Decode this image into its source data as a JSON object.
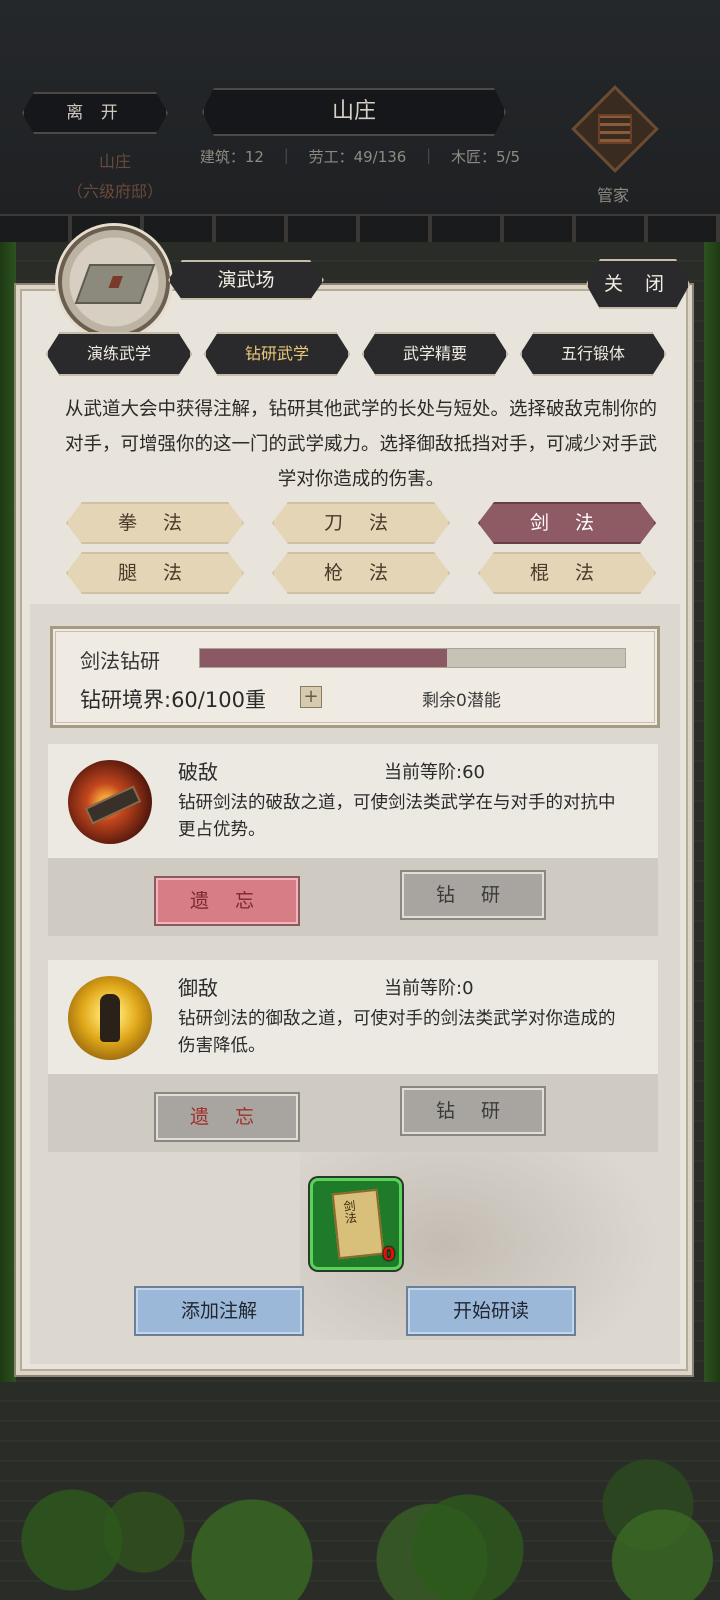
{
  "header": {
    "leave_label": "离 开",
    "location_title": "山庄",
    "location_name": "山庄",
    "location_rank": "（六级府邸）",
    "stats": {
      "buildings": "建筑：12",
      "workers": "劳工：49/136",
      "carpenters": "木匠：5/5"
    },
    "steward_label": "管家"
  },
  "panel": {
    "building_name": "演武场",
    "close_label": "关 闭",
    "tabs": [
      {
        "label": "演练武学",
        "active": false
      },
      {
        "label": "钻研武学",
        "active": true
      },
      {
        "label": "武学精要",
        "active": false
      },
      {
        "label": "五行锻体",
        "active": false
      }
    ],
    "description": "从武道大会中获得注解，钻研其他武学的长处与短处。选择破敌克制你的对手，可增强你的这一门的武学威力。选择御敌抵挡对手，可减少对手武学对你造成的伤害。",
    "weapon_types": [
      {
        "label": "拳 法",
        "active": false
      },
      {
        "label": "刀 法",
        "active": false
      },
      {
        "label": "剑 法",
        "active": true
      },
      {
        "label": "腿 法",
        "active": false
      },
      {
        "label": "枪 法",
        "active": false
      },
      {
        "label": "棍 法",
        "active": false
      }
    ],
    "study": {
      "title": "剑法钻研",
      "progress_fraction": 0.58,
      "level_text": "钻研境界:60/100重",
      "plus_label": "+",
      "remaining_text": "剩余0潜能"
    },
    "skills": [
      {
        "name": "破敌",
        "rank": "当前等阶:60",
        "description": "钻研剑法的破敌之道，可使剑法类武学在与对手的对抗中更占优势。",
        "forget_label": "遗 忘",
        "study_label": "钻 研"
      },
      {
        "name": "御敌",
        "rank": "当前等阶:0",
        "description": "钻研剑法的御敌之道，可使对手的剑法类武学对你造成的伤害降低。",
        "forget_label": "遗 忘",
        "study_label": "钻 研"
      }
    ],
    "item": {
      "book_title": "剑法",
      "count": "0"
    },
    "add_note_label": "添加注解",
    "start_study_label": "开始研读"
  },
  "colors": {
    "accent_maroon": "#8b5963",
    "active_tab_gold": "#e9c97a",
    "forget_red": "#d77d86",
    "blue_button": "#9cb8d8",
    "item_green": "#1f7a2a"
  }
}
